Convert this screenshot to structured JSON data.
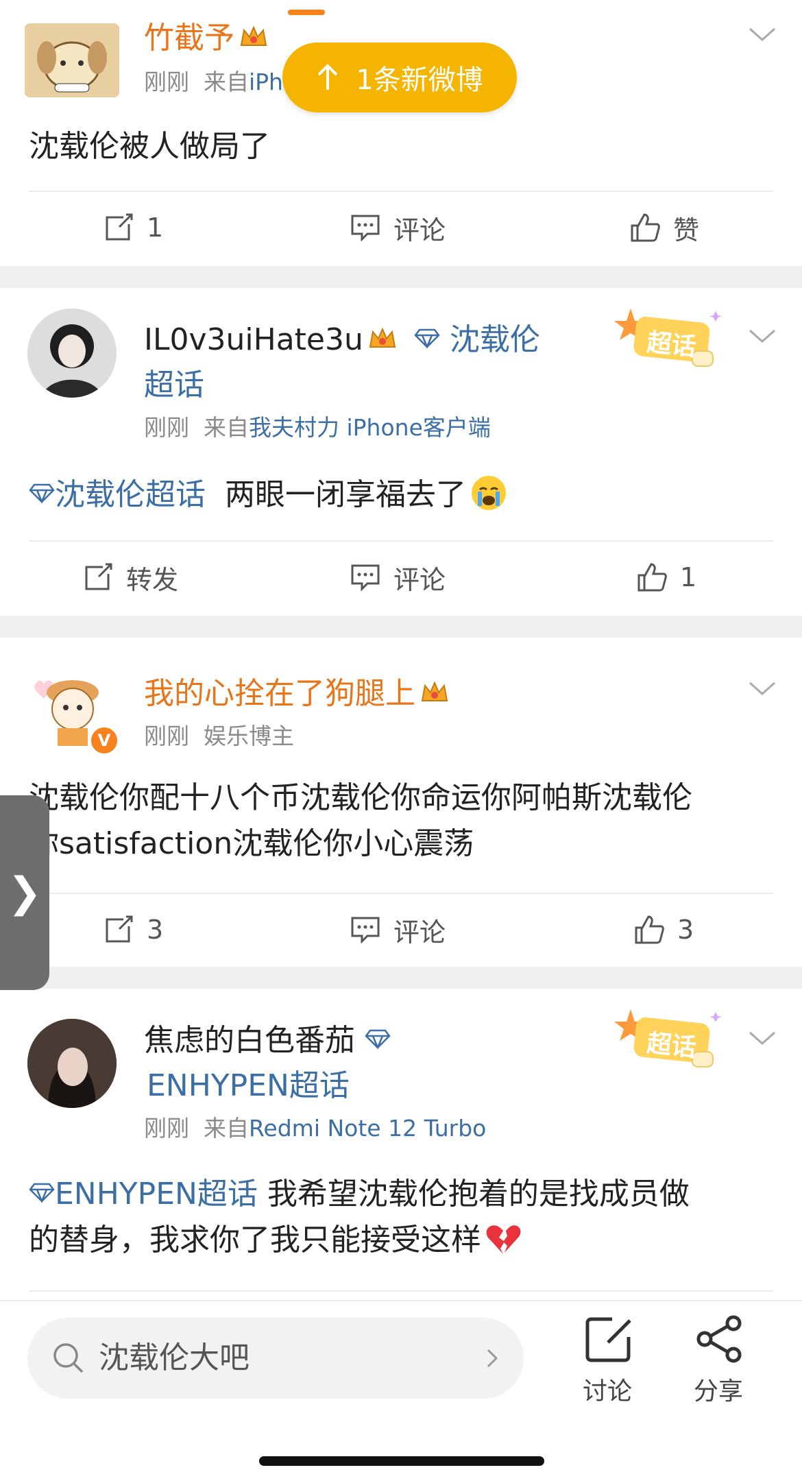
{
  "banner": {
    "label": "1条新微博"
  },
  "posts": [
    {
      "username": "竹截予",
      "meta_time": "刚刚",
      "meta_from": "来自",
      "meta_source": "iPhone",
      "content": "沈载伦被人做局了",
      "actions": {
        "repost": "1",
        "comment": "评论",
        "like": "赞"
      }
    },
    {
      "username": "IL0v3uiHate3u",
      "topic_tag": "沈载伦",
      "topic_tag2": "超话",
      "badge": "超话",
      "meta_time": "刚刚",
      "meta_from": "来自",
      "meta_source": "我夫村力 iPhone客户端",
      "content_topic": "沈载伦超话",
      "content": "两眼一闭享福去了",
      "actions": {
        "repost": "转发",
        "comment": "评论",
        "like": "1"
      }
    },
    {
      "username": "我的心拴在了狗腿上",
      "meta_time": "刚刚",
      "meta_role": "娱乐博主",
      "content_line1": "沈载伦你配十八个币沈载伦你命运你阿帕斯沈载伦",
      "content_line2": "你satisfaction沈载伦你小心震荡",
      "actions": {
        "repost": "3",
        "comment": "评论",
        "like": "3"
      }
    },
    {
      "username": "焦虑的白色番茄",
      "topic_tag": "ENHYPEN超话",
      "badge": "超话",
      "meta_time": "刚刚",
      "meta_from": "来自",
      "meta_source": "Redmi Note 12 Turbo",
      "content_topic": "ENHYPEN超话",
      "content_line1": "我希望沈载伦抱着的是找成员做",
      "content_line2": "的替身，我求你了我只能接受这样"
    }
  ],
  "bottom_bar": {
    "search_text": "沈载伦大吧",
    "discuss_label": "讨论",
    "share_label": "分享"
  },
  "colors": {
    "accent": "#f5b400",
    "orange_name": "#e8751a",
    "link": "#3b6ea5"
  },
  "side_tab_glyph": "❯"
}
